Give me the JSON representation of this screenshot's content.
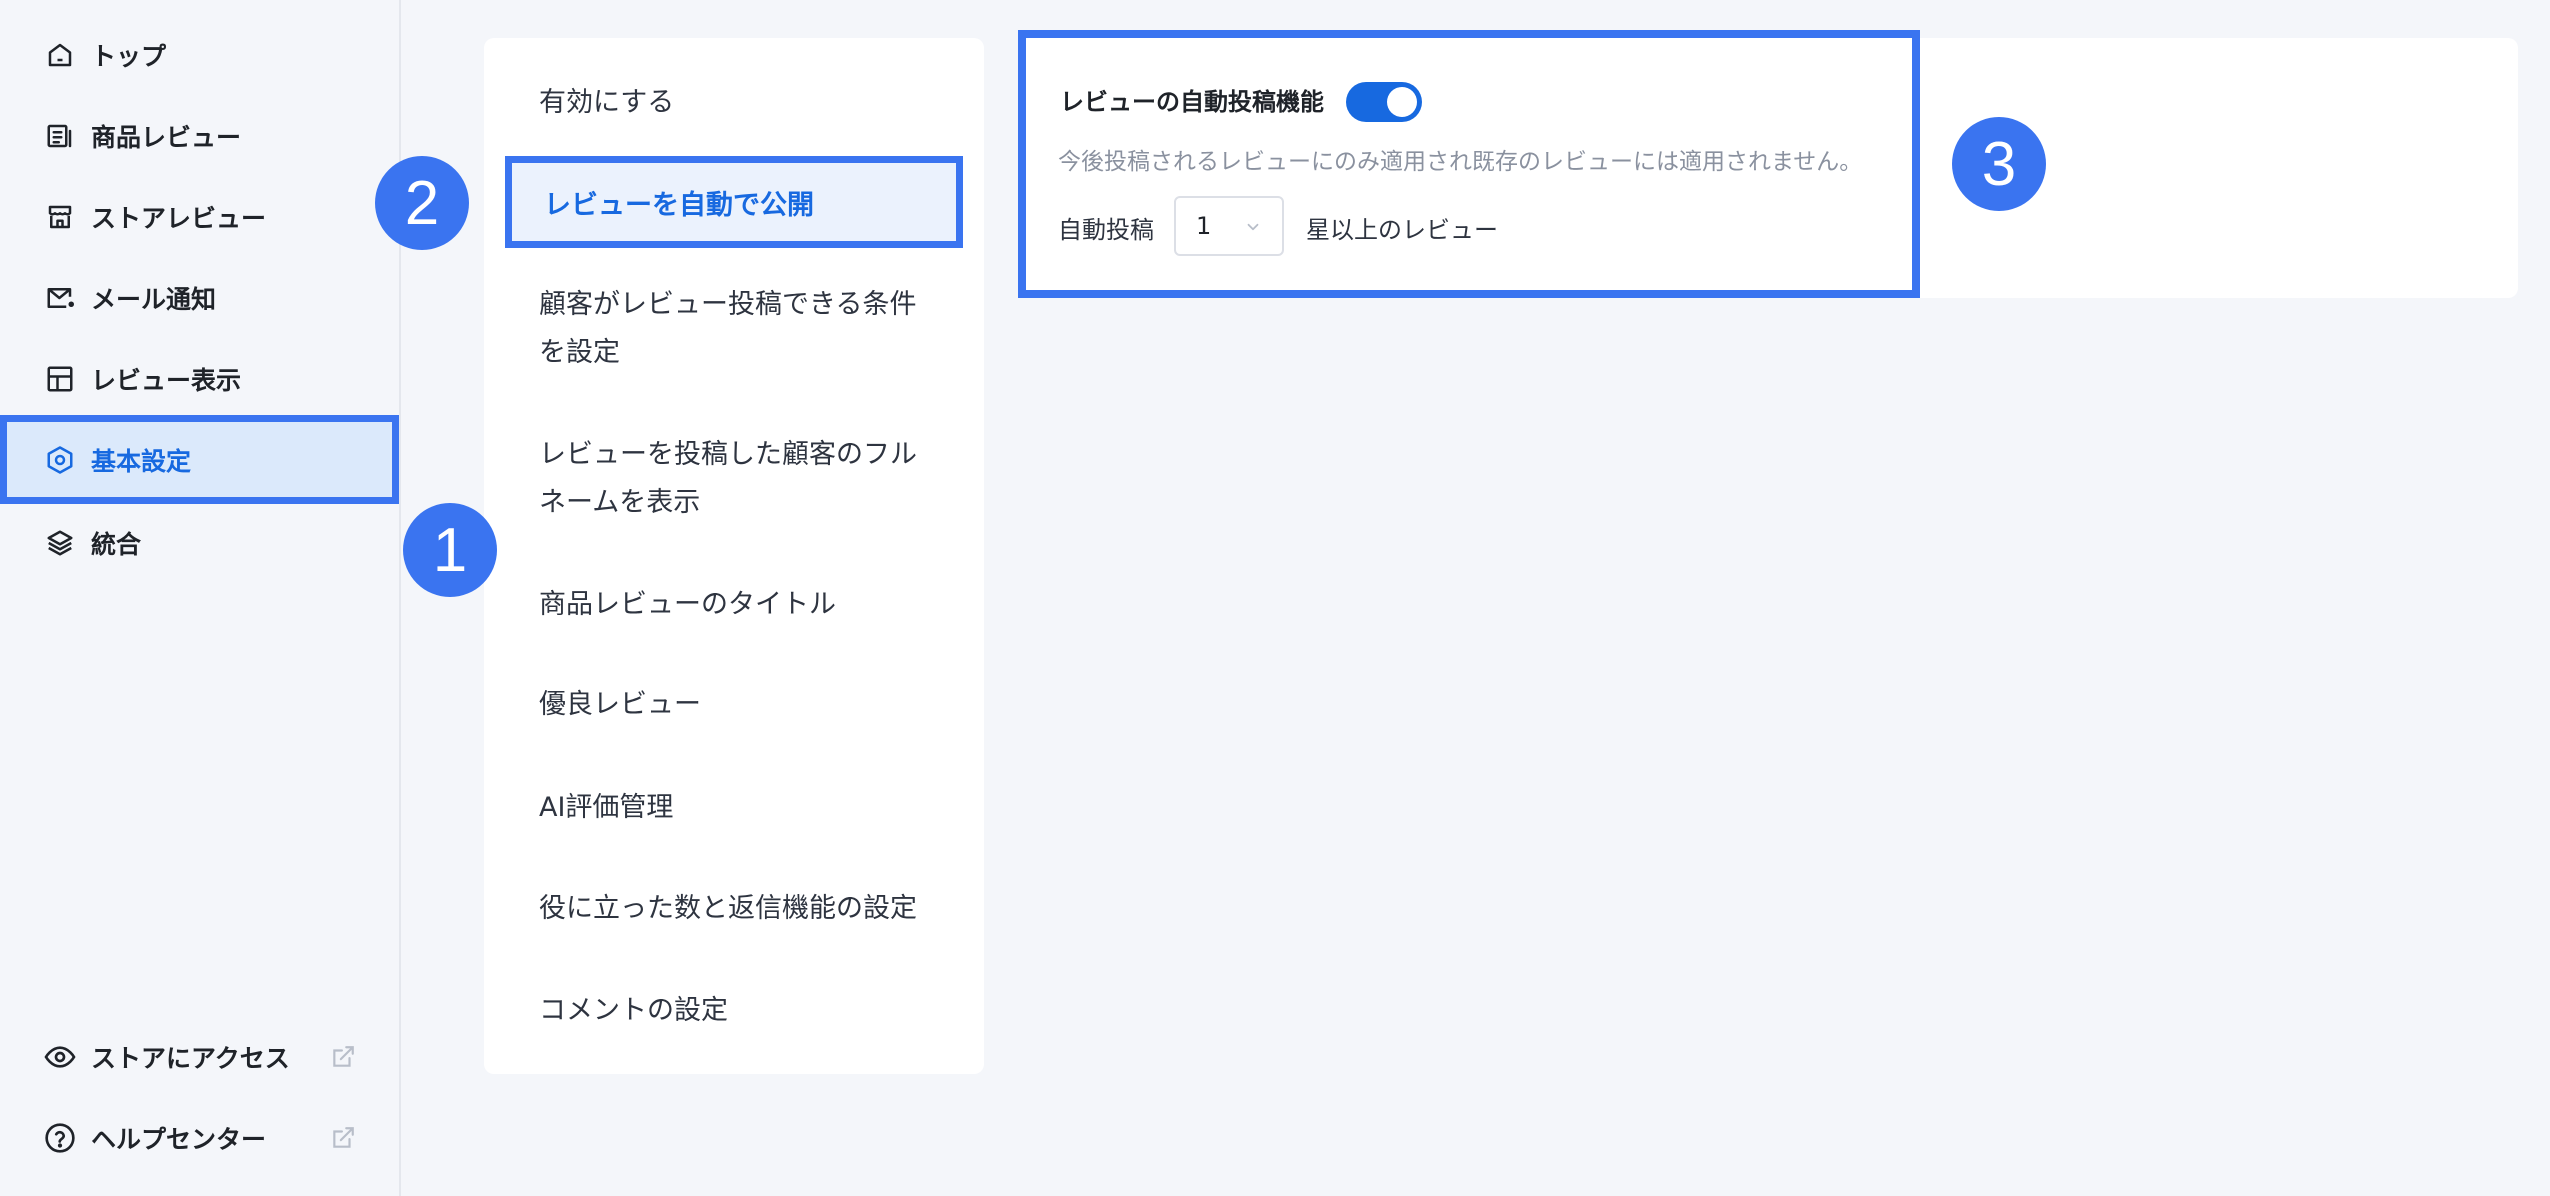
{
  "sidebar": {
    "items": [
      {
        "label": "トップ",
        "icon": "home-icon"
      },
      {
        "label": "商品レビュー",
        "icon": "product-review-icon"
      },
      {
        "label": "ストアレビュー",
        "icon": "store-icon"
      },
      {
        "label": "メール通知",
        "icon": "mail-icon"
      },
      {
        "label": "レビュー表示",
        "icon": "layout-icon"
      },
      {
        "label": "基本設定",
        "icon": "settings-hexagon-icon",
        "active": true
      },
      {
        "label": "統合",
        "icon": "layers-icon"
      }
    ],
    "footer": [
      {
        "label": "ストアにアクセス",
        "icon": "eye-icon",
        "external": true
      },
      {
        "label": "ヘルプセンター",
        "icon": "help-circle-icon",
        "external": true
      }
    ]
  },
  "settings_list": {
    "items": [
      {
        "label": "有効にする"
      },
      {
        "label": "レビューを自動で公開",
        "selected": true
      },
      {
        "label": "顧客がレビュー投稿できる条件を設定"
      },
      {
        "label": "レビューを投稿した顧客のフルネームを表示"
      },
      {
        "label": "商品レビューのタイトル"
      },
      {
        "label": "優良レビュー"
      },
      {
        "label": "AI評価管理"
      },
      {
        "label": "役に立った数と返信機能の設定"
      },
      {
        "label": "コメントの設定"
      }
    ]
  },
  "detail": {
    "title": "レビューの自動投稿機能",
    "toggle_on": true,
    "description": "今後投稿されるレビューにのみ適用され既存のレビューには適用されません。",
    "auto_post_label": "自動投稿",
    "star_select_value": "1",
    "suffix_label": "星以上のレビュー"
  },
  "badges": [
    "1",
    "2",
    "3"
  ],
  "colors": {
    "accent": "#1769e0",
    "highlight_border": "#3a74f0",
    "active_bg": "#dbe9fb",
    "page_bg": "#f4f6fa"
  }
}
